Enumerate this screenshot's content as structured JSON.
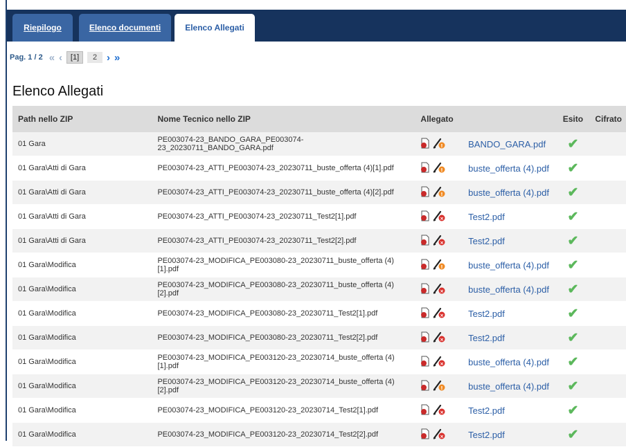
{
  "tabs": [
    {
      "label": "Riepilogo",
      "active": false
    },
    {
      "label": "Elenco documenti",
      "active": false
    },
    {
      "label": "Elenco Allegati",
      "active": true
    }
  ],
  "pager": {
    "label": "Pag. 1 / 2",
    "current": "[1]",
    "next_page": "2"
  },
  "page_title": "Elenco Allegati",
  "table": {
    "headers": [
      "Path nello ZIP",
      "Nome Tecnico nello ZIP",
      "Allegato",
      "Esito",
      "Cifrato"
    ],
    "rows": [
      {
        "path": "01 Gara",
        "nome": "PE003074-23_BANDO_GARA_PE003074-23_20230711_BANDO_GARA.pdf",
        "file": "BANDO_GARA.pdf",
        "warn": "orange"
      },
      {
        "path": "01 Gara\\Atti di Gara",
        "nome": "PE003074-23_ATTI_PE003074-23_20230711_buste_offerta (4)[1].pdf",
        "file": "buste_offerta (4).pdf",
        "warn": "orange"
      },
      {
        "path": "01 Gara\\Atti di Gara",
        "nome": "PE003074-23_ATTI_PE003074-23_20230711_buste_offerta (4)[2].pdf",
        "file": "buste_offerta (4).pdf",
        "warn": "orange"
      },
      {
        "path": "01 Gara\\Atti di Gara",
        "nome": "PE003074-23_ATTI_PE003074-23_20230711_Test2[1].pdf",
        "file": "Test2.pdf",
        "warn": "red"
      },
      {
        "path": "01 Gara\\Atti di Gara",
        "nome": "PE003074-23_ATTI_PE003074-23_20230711_Test2[2].pdf",
        "file": "Test2.pdf",
        "warn": "red"
      },
      {
        "path": "01 Gara\\Modifica",
        "nome": "PE003074-23_MODIFICA_PE003080-23_20230711_buste_offerta (4)[1].pdf",
        "file": "buste_offerta (4).pdf",
        "warn": "orange"
      },
      {
        "path": "01 Gara\\Modifica",
        "nome": "PE003074-23_MODIFICA_PE003080-23_20230711_buste_offerta (4)[2].pdf",
        "file": "buste_offerta (4).pdf",
        "warn": "red"
      },
      {
        "path": "01 Gara\\Modifica",
        "nome": "PE003074-23_MODIFICA_PE003080-23_20230711_Test2[1].pdf",
        "file": "Test2.pdf",
        "warn": "red"
      },
      {
        "path": "01 Gara\\Modifica",
        "nome": "PE003074-23_MODIFICA_PE003080-23_20230711_Test2[2].pdf",
        "file": "Test2.pdf",
        "warn": "red"
      },
      {
        "path": "01 Gara\\Modifica",
        "nome": "PE003074-23_MODIFICA_PE003120-23_20230714_buste_offerta (4)[1].pdf",
        "file": "buste_offerta (4).pdf",
        "warn": "red"
      },
      {
        "path": "01 Gara\\Modifica",
        "nome": "PE003074-23_MODIFICA_PE003120-23_20230714_buste_offerta (4)[2].pdf",
        "file": "buste_offerta (4).pdf",
        "warn": "orange"
      },
      {
        "path": "01 Gara\\Modifica",
        "nome": "PE003074-23_MODIFICA_PE003120-23_20230714_Test2[1].pdf",
        "file": "Test2.pdf",
        "warn": "red"
      },
      {
        "path": "01 Gara\\Modifica",
        "nome": "PE003074-23_MODIFICA_PE003120-23_20230714_Test2[2].pdf",
        "file": "Test2.pdf",
        "warn": "red"
      }
    ]
  },
  "colors": {
    "header_bar": "#16335d",
    "tab_inactive": "#3a66a3",
    "link": "#2b5ea6",
    "check": "#5cb85c",
    "warn_orange": "#f08a24",
    "warn_red": "#d9302c"
  }
}
